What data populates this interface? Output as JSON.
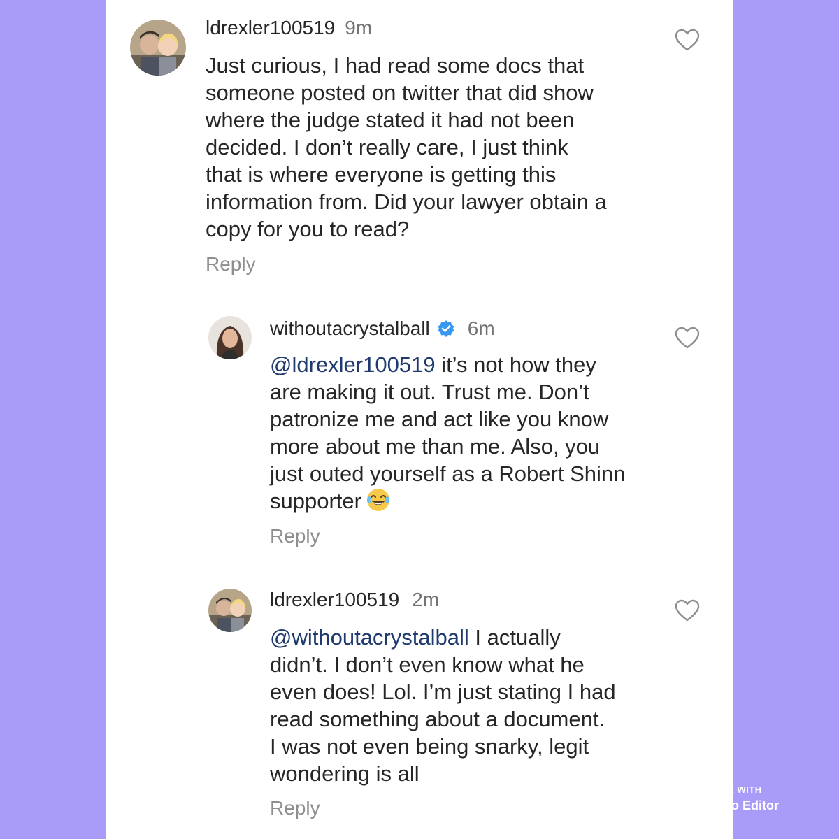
{
  "comments": [
    {
      "username": "ldrexler100519",
      "time": "9m",
      "verified": false,
      "lines": [
        "Just curious, I had read some docs that",
        "someone posted on twitter that did show",
        "where the judge stated it had not been",
        "decided. I don’t really care, I just think",
        "that is where everyone is getting this",
        "information from. Did your lawyer obtain a",
        "copy for you to read?"
      ],
      "reply_label": "Reply",
      "avatar_icon": "couple-selfie-avatar"
    },
    {
      "username": "withoutacrystalball",
      "time": "6m",
      "verified": true,
      "mention": "@ldrexler100519",
      "lines": [
        " it’s not how they",
        "are making it out. Trust me. Don’t",
        "patronize me and act like you know",
        "more about me than me. Also, you",
        "just outed yourself as a Robert Shinn",
        "supporter"
      ],
      "emoji": "tears-of-joy-emoji",
      "reply_label": "Reply",
      "avatar_icon": "woman-portrait-avatar"
    },
    {
      "username": "ldrexler100519",
      "time": "2m",
      "verified": false,
      "mention": "@withoutacrystalball",
      "lines": [
        " I actually",
        "didn’t. I don’t even know what he",
        "even does! Lol. I’m just stating I had",
        "read something about a document.",
        "I was not even being snarky, legit",
        "wondering is all"
      ],
      "reply_label": "Reply",
      "avatar_icon": "couple-selfie-avatar"
    }
  ],
  "watermark": {
    "made_with": "MADE WITH",
    "app_name": "Photo Editor"
  },
  "colors": {
    "background": "#a99cf9",
    "panel": "#ffffff",
    "text": "#262626",
    "muted": "#8e8e8e",
    "mention": "#1f3a6e",
    "verified": "#3897f0"
  }
}
